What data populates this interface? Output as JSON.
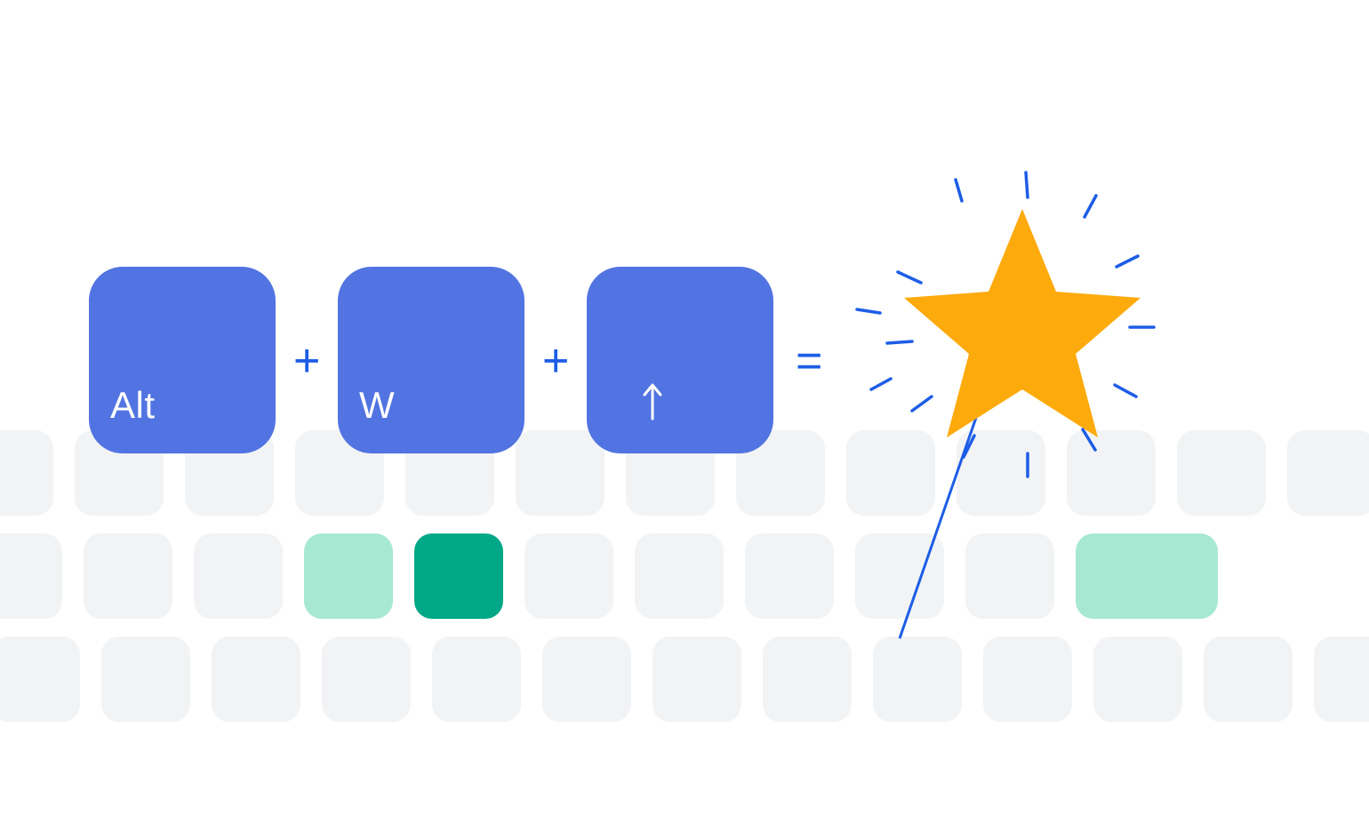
{
  "diagram": {
    "key1": "Alt",
    "key2": "W",
    "key3_icon": "arrow-up",
    "op_plus": "+",
    "op_equals": "=",
    "result_icon": "magic-wand-star"
  },
  "colors": {
    "key_blue": "#5274e2",
    "operator_blue": "#1d5de6",
    "bg_key": "#f2f3f5",
    "mint": "#a7e8d3",
    "teal": "#00a887",
    "star": "#fdaa0d"
  },
  "keyboard_layout": {
    "row1_count": 12,
    "row2": [
      "g",
      "g",
      "g",
      "mint",
      "teal",
      "g",
      "g",
      "g",
      "g",
      "g",
      "mint"
    ],
    "row3_count": 11
  }
}
